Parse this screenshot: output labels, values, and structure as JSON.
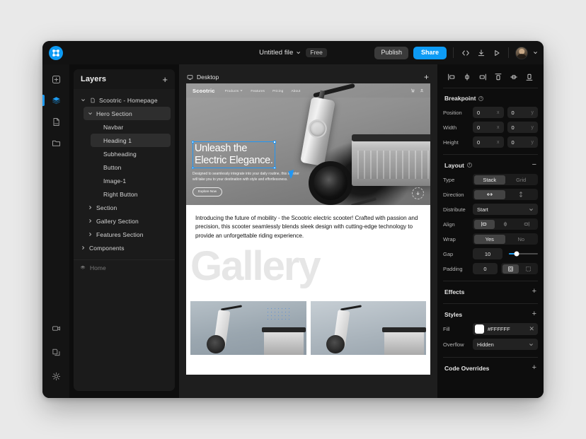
{
  "app": {
    "logo_icon": "app-logo-icon"
  },
  "topbar": {
    "file_name": "Untitled file",
    "plan_badge": "Free",
    "publish_label": "Publish",
    "share_label": "Share",
    "icons": [
      "code-icon",
      "download-icon",
      "preview-play-icon"
    ],
    "avatar": "user-avatar"
  },
  "rail": {
    "top_items": [
      {
        "name": "insert-icon",
        "active": false
      },
      {
        "name": "layers-icon",
        "active": true
      },
      {
        "name": "css-file-icon",
        "active": false
      },
      {
        "name": "assets-folder-icon",
        "active": false
      }
    ],
    "bottom_items": [
      {
        "name": "video-icon"
      },
      {
        "name": "pages-copy-icon"
      },
      {
        "name": "settings-gear-icon"
      }
    ]
  },
  "layers": {
    "title": "Layers",
    "add_label": "+",
    "tree": [
      {
        "label": "Scootric - Homepage",
        "depth": 0,
        "twisty": "down",
        "icon": "page-icon",
        "selected": false
      },
      {
        "label": "Hero Section",
        "depth": 1,
        "twisty": "down",
        "icon": "",
        "selected": true
      },
      {
        "label": "Navbar",
        "depth": 2,
        "twisty": "",
        "icon": "",
        "selected": false
      },
      {
        "label": "Heading 1",
        "depth": 2,
        "twisty": "",
        "icon": "",
        "selected": true
      },
      {
        "label": "Subheading",
        "depth": 2,
        "twisty": "",
        "icon": "",
        "selected": false
      },
      {
        "label": "Button",
        "depth": 2,
        "twisty": "",
        "icon": "",
        "selected": false
      },
      {
        "label": "Image-1",
        "depth": 2,
        "twisty": "",
        "icon": "",
        "selected": false
      },
      {
        "label": "Right Button",
        "depth": 2,
        "twisty": "",
        "icon": "",
        "selected": false
      },
      {
        "label": "Section",
        "depth": 1,
        "twisty": "right",
        "icon": "",
        "selected": false
      },
      {
        "label": "Gallery Section",
        "depth": 1,
        "twisty": "right",
        "icon": "",
        "selected": false
      },
      {
        "label": "Features Section",
        "depth": 1,
        "twisty": "right",
        "icon": "",
        "selected": false
      },
      {
        "label": "Components",
        "depth": 0,
        "twisty": "right",
        "icon": "",
        "selected": false
      }
    ],
    "footer": {
      "label": "Home",
      "icon": "layers-icon"
    }
  },
  "canvas": {
    "frame_label": "Desktop",
    "frame_icon": "desktop-icon",
    "add_frame_label": "+",
    "hero": {
      "brand": "Scootric",
      "nav_links": [
        "Products",
        "Features",
        "Pricing",
        "About"
      ],
      "nav_icons": [
        "cart-icon",
        "account-icon"
      ],
      "heading": "Unleash the\nElectric Elegance.",
      "subheading": "Designed to seamlessly integrate into your daily routine, this scooter will take you to your destination with style and effortlessness.",
      "cta": "Explore Now",
      "scroll_icon": "scroll-down-icon"
    },
    "intro": {
      "paragraph": "Introducing the future of mobility - the Scootric electric scooter! Crafted with passion and precision, this scooter seamlessly blends sleek design with cutting-edge technology to provide an unforgettable riding experience."
    },
    "gallery": {
      "word": "Gallery"
    }
  },
  "inspector": {
    "align_icons": [
      "align-left-icon",
      "align-center-horizontal-icon",
      "align-right-icon",
      "align-top-icon",
      "align-center-vertical-icon",
      "align-bottom-icon"
    ],
    "breakpoint": {
      "title": "Breakpoint",
      "rows": [
        {
          "label": "Position",
          "x": "0",
          "y": "0",
          "x_suffix": "x",
          "y_suffix": "y"
        },
        {
          "label": "Width",
          "x": "0",
          "y": "0",
          "x_suffix": "x",
          "y_suffix": "y"
        },
        {
          "label": "Height",
          "x": "0",
          "y": "0",
          "x_suffix": "x",
          "y_suffix": "y"
        }
      ]
    },
    "layout": {
      "title": "Layout",
      "collapse_label": "−",
      "type": {
        "label": "Type",
        "options": [
          "Stack",
          "Grid"
        ],
        "selected": "Stack"
      },
      "direction": {
        "label": "Direction",
        "options": [
          "horizontal-arrow-icon",
          "vertical-arrow-icon"
        ],
        "selected": "horizontal-arrow-icon"
      },
      "distribute": {
        "label": "Distribute",
        "value": "Start"
      },
      "align": {
        "label": "Align",
        "options": [
          "align-left-icon",
          "align-center-horizontal-icon",
          "align-right-icon"
        ],
        "selected": "align-left-icon"
      },
      "wrap": {
        "label": "Wrap",
        "options": [
          "Yes",
          "No"
        ],
        "selected": "Yes"
      },
      "gap": {
        "label": "Gap",
        "value": "10",
        "slider_percent": 26
      },
      "padding": {
        "label": "Padding",
        "value": "0",
        "modes": [
          "padding-all-icon",
          "padding-individual-icon"
        ],
        "selected": "padding-all-icon"
      }
    },
    "effects": {
      "title": "Effects",
      "action": "+"
    },
    "styles": {
      "title": "Styles",
      "action": "+",
      "fill": {
        "label": "Fill",
        "hex": "#FFFFFF",
        "swatch_color": "#FFFFFF",
        "clear": "✕"
      },
      "overflow": {
        "label": "Overflow",
        "value": "Hidden"
      }
    },
    "code_overrides": {
      "title": "Code Overrides",
      "action": "+"
    }
  }
}
